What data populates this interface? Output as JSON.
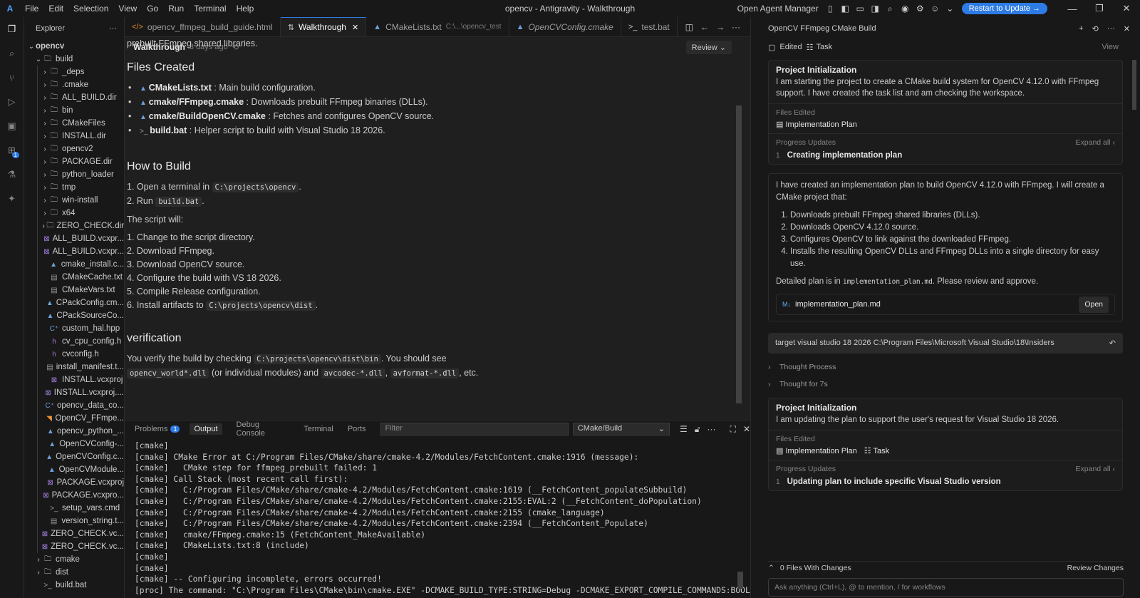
{
  "titlebar": {
    "menu": [
      "File",
      "Edit",
      "Selection",
      "View",
      "Go",
      "Run",
      "Terminal",
      "Help"
    ],
    "window_title": "opencv - Antigravity - Walkthrough",
    "agent_manager": "Open Agent Manager",
    "update_button": "Restart to Update →"
  },
  "activity": {
    "icons": [
      "explorer-icon",
      "search-icon",
      "source-control-icon",
      "run-debug-icon",
      "remote-icon",
      "extensions-icon",
      "testing-icon",
      "agent-icon"
    ],
    "extensions_badge": "1"
  },
  "explorer": {
    "title": "Explorer",
    "root": "opencv",
    "build_folder": "build",
    "build_children": [
      {
        "name": "_deps",
        "kind": "folder"
      },
      {
        "name": ".cmake",
        "kind": "folder"
      },
      {
        "name": "ALL_BUILD.dir",
        "kind": "folder"
      },
      {
        "name": "bin",
        "kind": "folder"
      },
      {
        "name": "CMakeFiles",
        "kind": "folder"
      },
      {
        "name": "INSTALL.dir",
        "kind": "folder"
      },
      {
        "name": "opencv2",
        "kind": "folder"
      },
      {
        "name": "PACKAGE.dir",
        "kind": "folder"
      },
      {
        "name": "python_loader",
        "kind": "folder"
      },
      {
        "name": "tmp",
        "kind": "folder"
      },
      {
        "name": "win-install",
        "kind": "folder"
      },
      {
        "name": "x64",
        "kind": "folder"
      },
      {
        "name": "ZERO_CHECK.dir",
        "kind": "folder"
      },
      {
        "name": "ALL_BUILD.vcxpr...",
        "kind": "vs"
      },
      {
        "name": "ALL_BUILD.vcxpr...",
        "kind": "vs"
      },
      {
        "name": "cmake_install.c...",
        "kind": "cmake"
      },
      {
        "name": "CMakeCache.txt",
        "kind": "file"
      },
      {
        "name": "CMakeVars.txt",
        "kind": "file"
      },
      {
        "name": "CPackConfig.cm...",
        "kind": "cmake"
      },
      {
        "name": "CPackSourceCo...",
        "kind": "cmake"
      },
      {
        "name": "custom_hal.hpp",
        "kind": "cpp"
      },
      {
        "name": "cv_cpu_config.h",
        "kind": "h"
      },
      {
        "name": "cvconfig.h",
        "kind": "h"
      },
      {
        "name": "install_manifest.t...",
        "kind": "file"
      },
      {
        "name": "INSTALL.vcxproj",
        "kind": "vs"
      },
      {
        "name": "INSTALL.vcxproj....",
        "kind": "vs"
      },
      {
        "name": "opencv_data_co...",
        "kind": "cpp"
      },
      {
        "name": "OpenCV_FFmpe...",
        "kind": "rss"
      },
      {
        "name": "opencv_python_...",
        "kind": "cmake"
      },
      {
        "name": "OpenCVConfig-...",
        "kind": "cmake"
      },
      {
        "name": "OpenCVConfig.c...",
        "kind": "cmake"
      },
      {
        "name": "OpenCVModule...",
        "kind": "cmake"
      },
      {
        "name": "PACKAGE.vcxproj",
        "kind": "vs"
      },
      {
        "name": "PACKAGE.vcxpro...",
        "kind": "vs"
      },
      {
        "name": "setup_vars.cmd",
        "kind": "term"
      },
      {
        "name": "version_string.t...",
        "kind": "file"
      },
      {
        "name": "ZERO_CHECK.vc...",
        "kind": "vs"
      },
      {
        "name": "ZERO_CHECK.vc...",
        "kind": "vs"
      }
    ],
    "after": [
      {
        "name": "cmake",
        "kind": "folder",
        "depth": 1
      },
      {
        "name": "dist",
        "kind": "folder",
        "depth": 1
      },
      {
        "name": "build.bat",
        "kind": "term",
        "depth": 1
      }
    ]
  },
  "tabs": [
    {
      "label": "opencv_ffmpeg_build_guide.html",
      "icon": "</>",
      "desc": "",
      "active": false
    },
    {
      "label": "Walkthrough",
      "icon": "⇅",
      "desc": "",
      "active": true
    },
    {
      "label": "CMakeLists.txt",
      "icon": "▲",
      "desc": "C:\\...\\opencv_test",
      "active": false
    },
    {
      "label": "OpenCVConfig.cmake",
      "icon": "▲",
      "desc": "",
      "active": false
    },
    {
      "label": "test.bat",
      "icon": ">_",
      "desc": "",
      "active": false
    }
  ],
  "editor": {
    "title": "Walkthrough",
    "ago": "3 days ago",
    "review": "Review",
    "intro": "prebuilt FFmpeg shared libraries.",
    "files_heading": "Files Created",
    "files": [
      {
        "name": "CMakeLists.txt",
        "desc": ": Main build configuration."
      },
      {
        "name": "cmake/FFmpeg.cmake",
        "desc": ": Downloads prebuilt FFmpeg binaries (DLLs)."
      },
      {
        "name": "cmake/BuildOpenCV.cmake",
        "desc": ": Fetches and configures OpenCV source."
      },
      {
        "name": "build.bat",
        "desc": ": Helper script to build with Visual Studio 18 2026."
      }
    ],
    "howto_heading": "How to Build",
    "step1_pre": "Open a terminal in",
    "step1_code": "C:\\projects\\opencv",
    "step2_pre": "Run",
    "step2_code": "build.bat",
    "script_will": "The script will:",
    "script_steps": [
      "Change to the script directory.",
      "Download FFmpeg.",
      "Download OpenCV source.",
      "Configure the build with VS 18 2026.",
      "Compile Release configuration."
    ],
    "step6_pre": "Install artifacts to",
    "step6_code": "C:\\projects\\opencv\\dist",
    "verify_heading": "verification",
    "verify_pre": "You verify the build by checking",
    "verify_code1": "C:\\projects\\opencv\\dist\\bin",
    "verify_mid": ". You should see",
    "verify_code2": "opencv_world*.dll",
    "verify_mid2": "(or individual modules) and",
    "verify_code3": "avcodec-*.dll",
    "verify_code4": "avformat-*.dll",
    "verify_end": ", etc."
  },
  "panel": {
    "tabs": [
      "Problems",
      "Output",
      "Debug Console",
      "Terminal",
      "Ports"
    ],
    "problems_badge": "1",
    "filter_placeholder": "Filter",
    "channel": "CMake/Build",
    "lines": [
      "[cmake]",
      "[cmake] CMake Error at C:/Program Files/CMake/share/cmake-4.2/Modules/FetchContent.cmake:1916 (message):",
      "[cmake]   CMake step for ffmpeg_prebuilt failed: 1",
      "[cmake] Call Stack (most recent call first):",
      "[cmake]   C:/Program Files/CMake/share/cmake-4.2/Modules/FetchContent.cmake:1619 (__FetchContent_populateSubbuild)",
      "[cmake]   C:/Program Files/CMake/share/cmake-4.2/Modules/FetchContent.cmake:2155:EVAL:2 (__FetchContent_doPopulation)",
      "[cmake]   C:/Program Files/CMake/share/cmake-4.2/Modules/FetchContent.cmake:2155 (cmake_language)",
      "[cmake]   C:/Program Files/CMake/share/cmake-4.2/Modules/FetchContent.cmake:2394 (__FetchContent_Populate)",
      "[cmake]   cmake/FFmpeg.cmake:15 (FetchContent_MakeAvailable)",
      "[cmake]   CMakeLists.txt:8 (include)",
      "[cmake]",
      "[cmake]",
      "[cmake] -- Configuring incomplete, errors occurred!",
      "[proc] The command: \"C:\\Program Files\\CMake\\bin\\cmake.EXE\" -DCMAKE_BUILD_TYPE:STRING=Debug -DCMAKE_EXPORT_COMPILE_COMMANDS:BOOL=TRUE"
    ]
  },
  "agent": {
    "title": "OpenCV FFmpeg CMake Build",
    "edited": "Edited",
    "task": "Task",
    "view": "View",
    "card1": {
      "title": "Project Initialization",
      "text": "I am starting the project to create a CMake build system for OpenCV 4.12.0 with FFmpeg support. I have created the task list and am checking the workspace.",
      "files_edited_label": "Files Edited",
      "file": "Implementation Plan",
      "progress_label": "Progress Updates",
      "expand": "Expand all",
      "item_num": "1",
      "item": "Creating implementation plan"
    },
    "msg": {
      "intro": "I have created an implementation plan to build OpenCV 4.12.0 with FFmpeg. I will create a CMake project that:",
      "steps": [
        "Downloads prebuilt FFmpeg shared libraries (DLLs).",
        "Downloads OpenCV 4.12.0 source.",
        "Configures OpenCV to link against the downloaded FFmpeg.",
        "Installs the resulting OpenCV DLLs and FFmpeg DLLs into a single directory for easy use."
      ],
      "detail_pre": "Detailed plan is in",
      "detail_code": "implementation_plan.md",
      "detail_post": ". Please review and approve.",
      "file": "implementation_plan.md",
      "open": "Open"
    },
    "user_msg": "target visual studio 18 2026 C:\\Program Files\\Microsoft Visual Studio\\18\\Insiders",
    "thought1": "Thought Process",
    "thought2": "Thought for 7s",
    "card2": {
      "title": "Project Initialization",
      "text": "I am updating the plan to support the user's request for Visual Studio 18 2026.",
      "files_edited_label": "Files Edited",
      "file": "Implementation Plan",
      "task": "Task",
      "progress_label": "Progress Updates",
      "expand": "Expand all",
      "item_num": "1",
      "item": "Updating plan to include specific Visual Studio version"
    },
    "footer": {
      "files_changes": "0 Files With Changes",
      "review_changes": "Review Changes",
      "ask_placeholder": "Ask anything (Ctrl+L), @ to mention, / for workflows"
    }
  }
}
